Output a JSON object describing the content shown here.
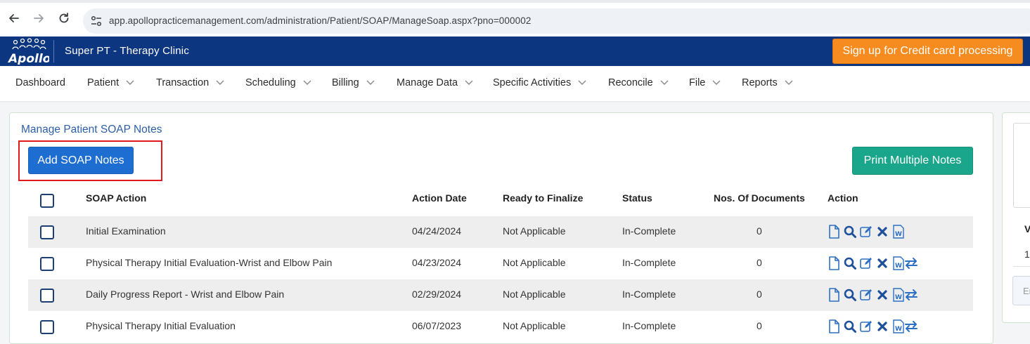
{
  "browser": {
    "url": "app.apollopracticemanagement.com/administration/Patient/SOAP/ManageSoap.aspx?pno=000002"
  },
  "header": {
    "logo_text": "Apollo",
    "clinic_name": "Super PT - Therapy Clinic",
    "signup_label": "Sign up for Credit card processing",
    "accent_color": "#f68b1f",
    "bar_color": "#0d3680"
  },
  "menu": {
    "items": [
      {
        "label": "Dashboard",
        "has_dropdown": false
      },
      {
        "label": "Patient",
        "has_dropdown": true
      },
      {
        "label": "Transaction",
        "has_dropdown": true
      },
      {
        "label": "Scheduling",
        "has_dropdown": true
      },
      {
        "label": "Billing",
        "has_dropdown": true
      },
      {
        "label": "Manage Data",
        "has_dropdown": true
      },
      {
        "label": "Specific Activities",
        "has_dropdown": true
      },
      {
        "label": "Reconcile",
        "has_dropdown": true
      },
      {
        "label": "File",
        "has_dropdown": true
      },
      {
        "label": "Reports",
        "has_dropdown": true
      }
    ]
  },
  "panel": {
    "title": "Manage Patient SOAP Notes",
    "add_label": "Add SOAP Notes",
    "print_label": "Print Multiple Notes"
  },
  "table": {
    "headers": [
      "SOAP Action",
      "Action Date",
      "Ready to Finalize",
      "Status",
      "Nos. Of Documents",
      "Action"
    ],
    "rows": [
      {
        "action": "Initial Examination",
        "date": "04/24/2024",
        "ready": "Not Applicable",
        "status": "In-Complete",
        "docs": "0",
        "icons": [
          "document-icon",
          "search-icon",
          "edit-icon",
          "delete-icon",
          "word-icon"
        ]
      },
      {
        "action": "Physical Therapy Initial Evaluation-Wrist and Elbow Pain",
        "date": "04/23/2024",
        "ready": "Not Applicable",
        "status": "In-Complete",
        "docs": "0",
        "icons": [
          "document-icon",
          "search-icon",
          "edit-icon",
          "delete-icon",
          "word-icon",
          "transfer-icon"
        ]
      },
      {
        "action": "Daily Progress Report - Wrist and Elbow Pain",
        "date": "02/29/2024",
        "ready": "Not Applicable",
        "status": "In-Complete",
        "docs": "0",
        "icons": [
          "document-icon",
          "search-icon",
          "edit-icon",
          "delete-icon",
          "word-icon",
          "transfer-icon"
        ]
      },
      {
        "action": "Physical Therapy Initial Evaluation",
        "date": "06/07/2023",
        "ready": "Not Applicable",
        "status": "In-Complete",
        "docs": "0",
        "icons": [
          "document-icon",
          "search-icon",
          "edit-icon",
          "delete-icon",
          "word-icon",
          "transfer-icon"
        ]
      }
    ]
  },
  "side": {
    "heading": "V",
    "value": "1",
    "input_placeholder": "Er"
  }
}
